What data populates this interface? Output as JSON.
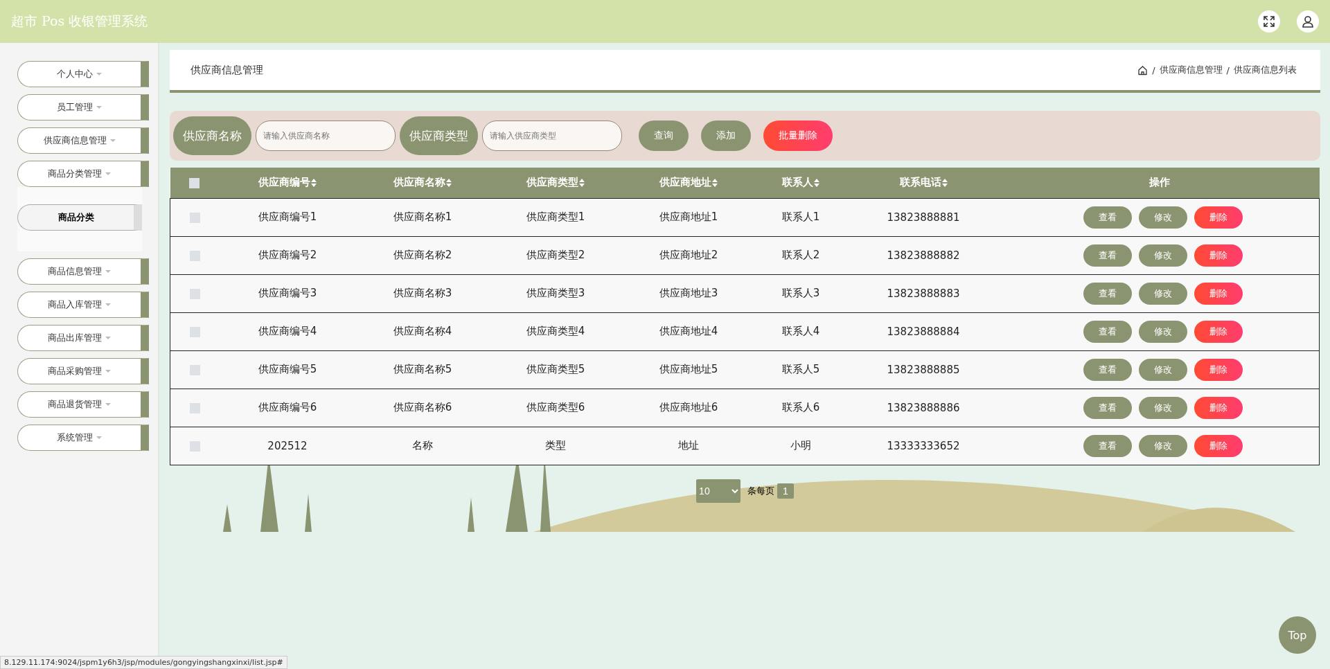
{
  "header": {
    "title": "超市 Pos 收银管理系统"
  },
  "sidebar": {
    "items": [
      {
        "label": "个人中心",
        "expanded": false
      },
      {
        "label": "员工管理",
        "expanded": false
      },
      {
        "label": "供应商信息管理",
        "expanded": false
      },
      {
        "label": "商品分类管理",
        "expanded": true,
        "children": [
          {
            "label": "商品分类",
            "selected": true
          }
        ]
      },
      {
        "label": "商品信息管理",
        "expanded": false
      },
      {
        "label": "商品入库管理",
        "expanded": false
      },
      {
        "label": "商品出库管理",
        "expanded": false
      },
      {
        "label": "商品采购管理",
        "expanded": false
      },
      {
        "label": "商品退货管理",
        "expanded": false
      },
      {
        "label": "系统管理",
        "expanded": false
      }
    ]
  },
  "page_title": "供应商信息管理",
  "breadcrumb": [
    {
      "separator": "/",
      "label": "供应商信息管理"
    },
    {
      "separator": "/",
      "label": "供应商信息列表"
    }
  ],
  "search": {
    "fields": [
      {
        "label": "供应商名称",
        "placeholder": "请输入供应商名称"
      },
      {
        "label": "供应商类型",
        "placeholder": "请输入供应商类型"
      }
    ],
    "buttons": [
      {
        "label": "查询",
        "kind": "normal"
      },
      {
        "label": "添加",
        "kind": "normal"
      },
      {
        "label": "批量删除",
        "kind": "danger"
      }
    ]
  },
  "table": {
    "columns": [
      {
        "label": "供应商编号",
        "sortable": true
      },
      {
        "label": "供应商名称",
        "sortable": true
      },
      {
        "label": "供应商类型",
        "sortable": true
      },
      {
        "label": "供应商地址",
        "sortable": true
      },
      {
        "label": "联系人",
        "sortable": true
      },
      {
        "label": "联系电话",
        "sortable": true
      },
      {
        "label": "操作",
        "sortable": false
      }
    ],
    "header_checked": false,
    "rows": [
      {
        "checked": false,
        "cells": [
          "供应商编号1",
          "供应商名称1",
          "供应商类型1",
          "供应商地址1",
          "联系人1",
          "13823888881"
        ],
        "actions": [
          {
            "label": "查看",
            "kind": "normal"
          },
          {
            "label": "修改",
            "kind": "normal"
          },
          {
            "label": "删除",
            "kind": "danger"
          }
        ]
      },
      {
        "checked": false,
        "cells": [
          "供应商编号2",
          "供应商名称2",
          "供应商类型2",
          "供应商地址2",
          "联系人2",
          "13823888882"
        ],
        "actions": [
          {
            "label": "查看",
            "kind": "normal"
          },
          {
            "label": "修改",
            "kind": "normal"
          },
          {
            "label": "删除",
            "kind": "danger"
          }
        ]
      },
      {
        "checked": false,
        "cells": [
          "供应商编号3",
          "供应商名称3",
          "供应商类型3",
          "供应商地址3",
          "联系人3",
          "13823888883"
        ],
        "actions": [
          {
            "label": "查看",
            "kind": "normal"
          },
          {
            "label": "修改",
            "kind": "normal"
          },
          {
            "label": "删除",
            "kind": "danger"
          }
        ]
      },
      {
        "checked": false,
        "cells": [
          "供应商编号4",
          "供应商名称4",
          "供应商类型4",
          "供应商地址4",
          "联系人4",
          "13823888884"
        ],
        "actions": [
          {
            "label": "查看",
            "kind": "normal"
          },
          {
            "label": "修改",
            "kind": "normal"
          },
          {
            "label": "删除",
            "kind": "danger"
          }
        ]
      },
      {
        "checked": false,
        "cells": [
          "供应商编号5",
          "供应商名称5",
          "供应商类型5",
          "供应商地址5",
          "联系人5",
          "13823888885"
        ],
        "actions": [
          {
            "label": "查看",
            "kind": "normal"
          },
          {
            "label": "修改",
            "kind": "normal"
          },
          {
            "label": "删除",
            "kind": "danger"
          }
        ]
      },
      {
        "checked": false,
        "cells": [
          "供应商编号6",
          "供应商名称6",
          "供应商类型6",
          "供应商地址6",
          "联系人6",
          "13823888886"
        ],
        "actions": [
          {
            "label": "查看",
            "kind": "normal"
          },
          {
            "label": "修改",
            "kind": "normal"
          },
          {
            "label": "删除",
            "kind": "danger"
          }
        ]
      },
      {
        "checked": false,
        "cells": [
          "202512",
          "名称",
          "类型",
          "地址",
          "小明",
          "13333333652"
        ],
        "actions": [
          {
            "label": "查看",
            "kind": "normal"
          },
          {
            "label": "修改",
            "kind": "normal"
          },
          {
            "label": "删除",
            "kind": "danger"
          }
        ]
      }
    ]
  },
  "pagination": {
    "page_size": "10",
    "per_page_label": "条每页",
    "pages": [
      {
        "label": "1",
        "selected": true
      }
    ]
  },
  "top_button": "Top",
  "status_url": "8.129.11.174:9024/jspm1y6h3/jsp/modules/gongyingshangxinxi/list.jsp#"
}
